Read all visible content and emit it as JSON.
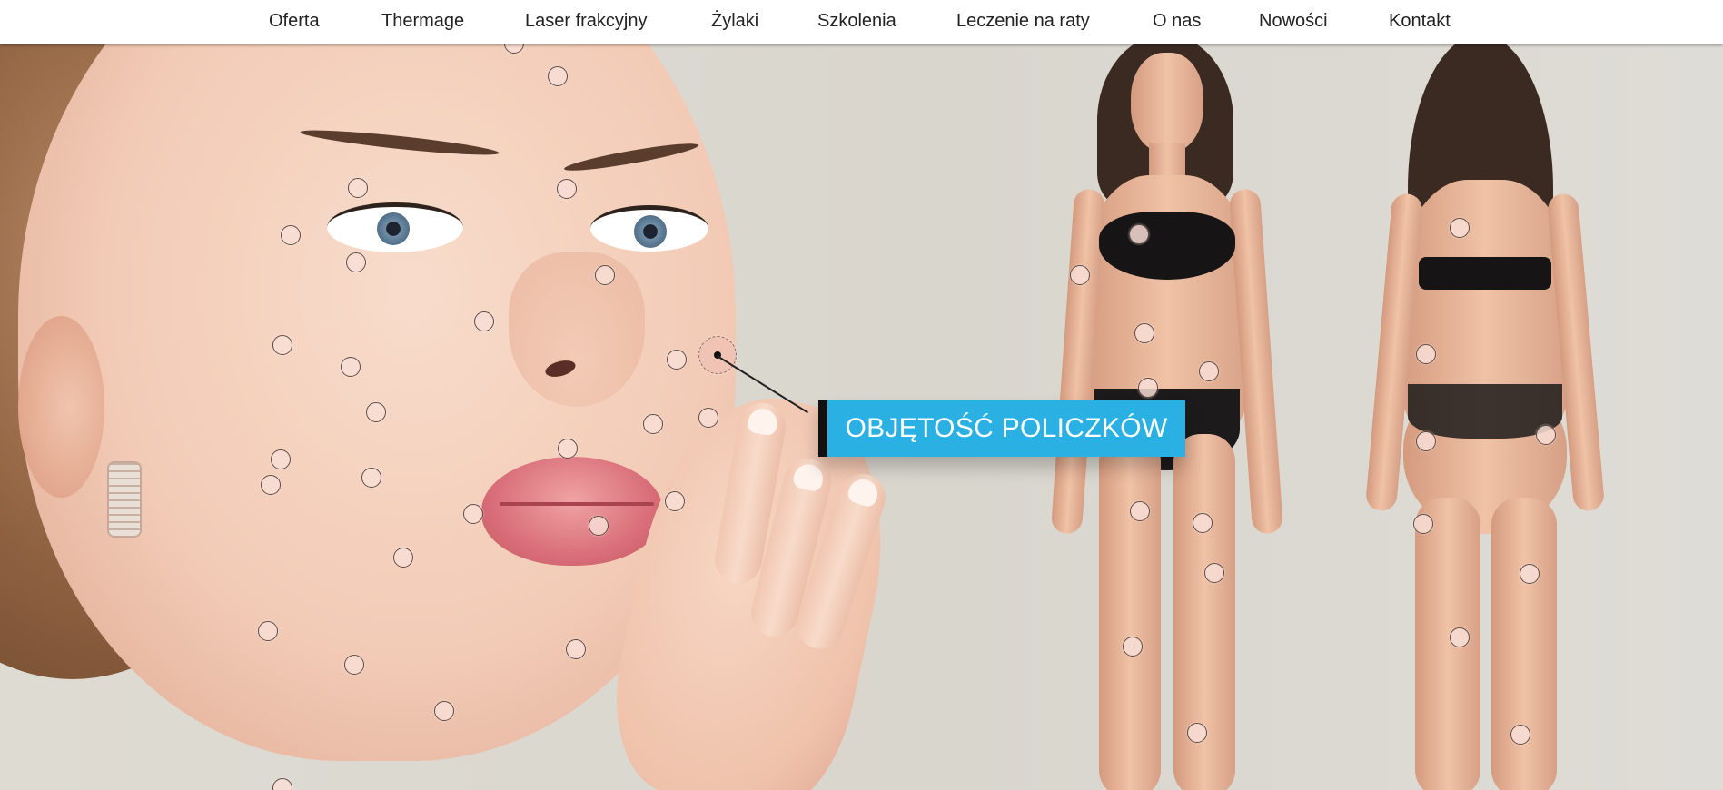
{
  "nav": {
    "items": [
      {
        "label": "Oferta"
      },
      {
        "label": "Thermage"
      },
      {
        "label": "Laser frakcyjny"
      },
      {
        "label": "Żylaki"
      },
      {
        "label": "Szkolenia"
      },
      {
        "label": "Leczenie na raty"
      },
      {
        "label": "O nas"
      },
      {
        "label": "Nowości"
      },
      {
        "label": "Kontakt"
      }
    ]
  },
  "hero": {
    "active_label": "OBJĘTOŚĆ POLICZKÓW",
    "accent_color": "#2ab0e3",
    "illustrations": [
      "woman-face-with-hand",
      "female-body-front",
      "female-body-back"
    ]
  }
}
